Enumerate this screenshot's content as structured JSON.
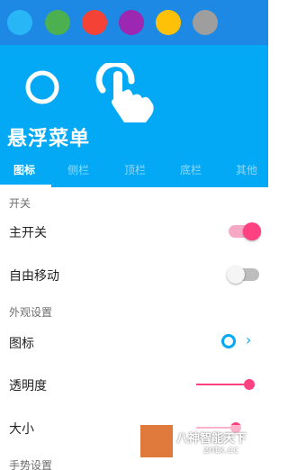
{
  "colors": {
    "swatch_bar_bg": "#1e88e5",
    "header_bg": "#03a9f4",
    "accent": "#ff4081",
    "swatches": [
      "#29b6f6",
      "#4caf50",
      "#f44336",
      "#9c27b0",
      "#ffc107",
      "#9e9e9e"
    ]
  },
  "header": {
    "title": "悬浮菜单",
    "icons": [
      "ring-icon",
      "touch-icon"
    ]
  },
  "tabs": [
    {
      "label": "图标",
      "active": true
    },
    {
      "label": "侧栏",
      "active": false
    },
    {
      "label": "顶栏",
      "active": false
    },
    {
      "label": "底栏",
      "active": false
    },
    {
      "label": "其他",
      "active": false
    }
  ],
  "settings": {
    "section_switch": "开关",
    "master_switch": {
      "label": "主开关",
      "on": true
    },
    "free_move": {
      "label": "自由移动",
      "on": false
    },
    "section_appearance": "外观设置",
    "icon_row": {
      "label": "图标",
      "icon": "ring-icon",
      "chevron": "›"
    },
    "opacity": {
      "label": "透明度",
      "value": 1.0
    },
    "size": {
      "label": "大小",
      "value": 0.85
    },
    "section_gesture": "手势设置"
  },
  "watermark": {
    "text": "八神智能天下",
    "url": "zntx.cc"
  }
}
